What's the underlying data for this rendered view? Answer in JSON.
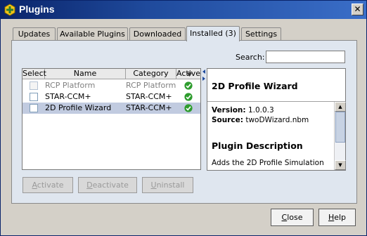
{
  "window": {
    "title": "Plugins",
    "close_label": "✕"
  },
  "tabs": [
    {
      "label": "Updates",
      "active": false
    },
    {
      "label": "Available Plugins",
      "active": false
    },
    {
      "label": "Downloaded",
      "active": false
    },
    {
      "label": "Installed (3)",
      "active": true
    },
    {
      "label": "Settings",
      "active": false
    }
  ],
  "search": {
    "label": "Search:",
    "value": "",
    "placeholder": ""
  },
  "table": {
    "columns": [
      "Select",
      "Name",
      "Category",
      "Active"
    ],
    "rows": [
      {
        "name": "RCP Platform",
        "category": "RCP Platform",
        "selected": false,
        "checked": false,
        "active": true,
        "disabled": true
      },
      {
        "name": "STAR-CCM+",
        "category": "STAR-CCM+",
        "selected": false,
        "checked": false,
        "active": true,
        "disabled": false
      },
      {
        "name": "2D Profile Wizard",
        "category": "STAR-CCM+",
        "selected": true,
        "checked": false,
        "active": true,
        "disabled": false
      }
    ]
  },
  "details": {
    "title": "2D Profile Wizard",
    "version_label": "Version:",
    "version": "1.0.0.3",
    "source_label": "Source:",
    "source": "twoDWizard.nbm",
    "description_heading": "Plugin Description",
    "description": "Adds the 2D Profile Simulation"
  },
  "actions": {
    "activate": {
      "mnemonic": "A",
      "rest": "ctivate"
    },
    "deactivate": {
      "mnemonic": "D",
      "rest": "eactivate"
    },
    "uninstall": {
      "mnemonic": "U",
      "rest": "ninstall"
    }
  },
  "footer": {
    "close": {
      "mnemonic": "C",
      "rest": "lose"
    },
    "help": {
      "mnemonic": "H",
      "rest": "elp"
    }
  },
  "colors": {
    "title_bar": "#0a246a",
    "selection": "#c1cbe0",
    "active_ok": "#2e9c2e",
    "panel": "#dfe6ef"
  }
}
